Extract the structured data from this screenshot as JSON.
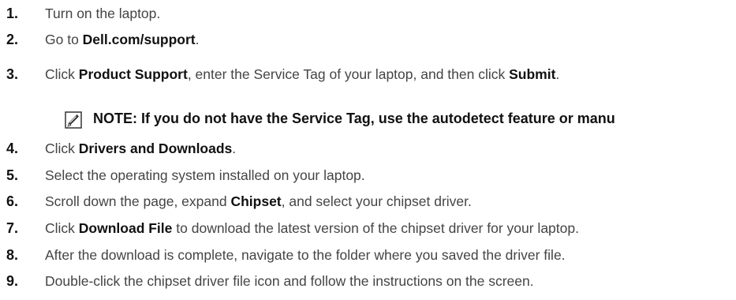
{
  "steps": [
    {
      "num": "1.",
      "parts": [
        {
          "t": "Turn on the laptop."
        }
      ]
    },
    {
      "num": "2.",
      "parts": [
        {
          "t": "Go to "
        },
        {
          "b": "Dell.com/support"
        },
        {
          "t": "."
        }
      ]
    },
    {
      "num": "3.",
      "parts": [
        {
          "t": "Click "
        },
        {
          "b": "Product Support"
        },
        {
          "t": ", enter the Service Tag of your laptop, and then click "
        },
        {
          "b": "Submit"
        },
        {
          "t": "."
        }
      ]
    },
    {
      "num": "4.",
      "parts": [
        {
          "t": "Click "
        },
        {
          "b": "Drivers and Downloads"
        },
        {
          "t": "."
        }
      ]
    },
    {
      "num": "5.",
      "parts": [
        {
          "t": "Select the operating system installed on your laptop."
        }
      ]
    },
    {
      "num": "6.",
      "parts": [
        {
          "t": "Scroll down the page, expand "
        },
        {
          "b": "Chipset"
        },
        {
          "t": ", and select your chipset driver."
        }
      ]
    },
    {
      "num": "7.",
      "parts": [
        {
          "t": "Click "
        },
        {
          "b": "Download File"
        },
        {
          "t": " to download the latest version of the chipset driver for your laptop."
        }
      ]
    },
    {
      "num": "8.",
      "parts": [
        {
          "t": "After the download is complete, navigate to the folder where you saved the driver file."
        }
      ]
    },
    {
      "num": "9.",
      "parts": [
        {
          "t": "Double-click the chipset driver file icon and follow the instructions on the screen."
        }
      ]
    }
  ],
  "note": {
    "icon": "note-pencil-icon",
    "text": "NOTE: If you do not have the Service Tag, use the autodetect feature or manu"
  }
}
